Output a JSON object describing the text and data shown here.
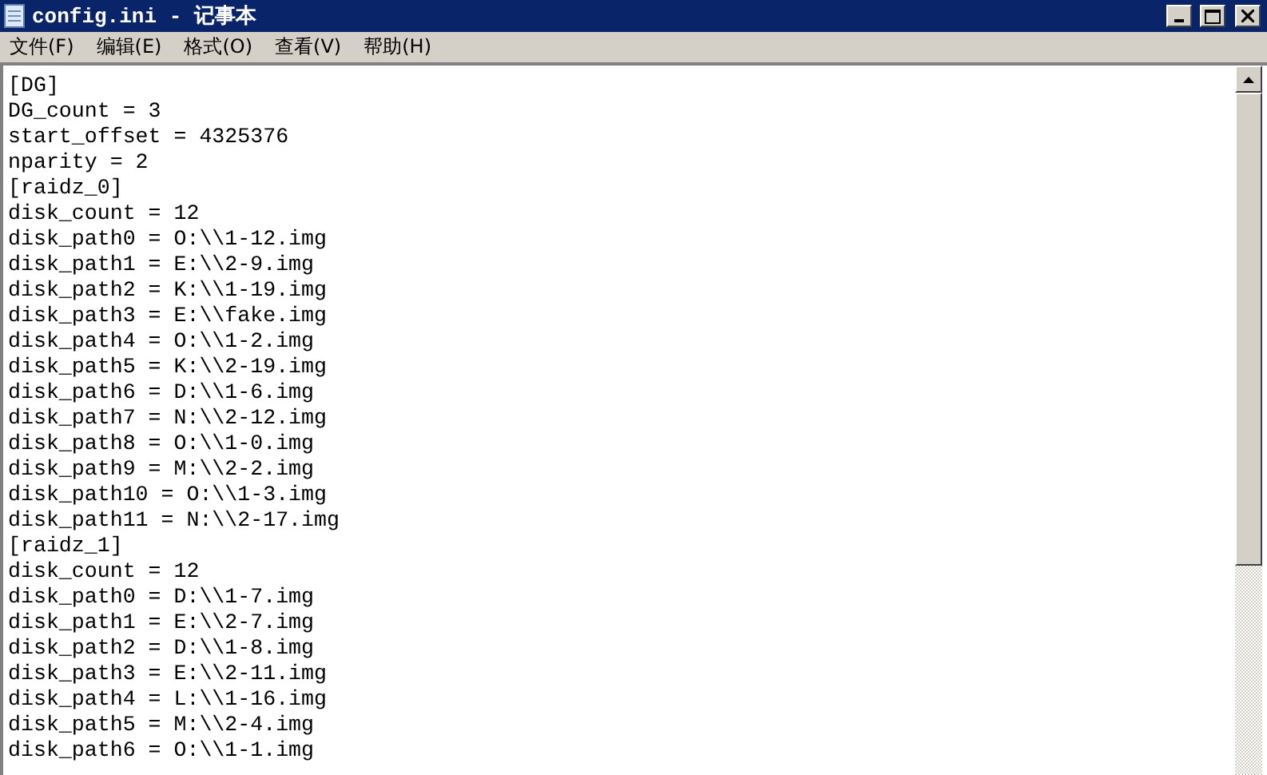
{
  "window": {
    "title": "config.ini - 记事本"
  },
  "menu": [
    "文件(F)",
    "编辑(E)",
    "格式(O)",
    "查看(V)",
    "帮助(H)"
  ],
  "editor": {
    "lines": [
      "[DG]",
      "DG_count = 3",
      "start_offset = 4325376",
      "nparity = 2",
      "[raidz_0]",
      "disk_count = 12",
      "disk_path0 = O:\\\\1-12.img",
      "disk_path1 = E:\\\\2-9.img",
      "disk_path2 = K:\\\\1-19.img",
      "disk_path3 = E:\\\\fake.img",
      "disk_path4 = O:\\\\1-2.img",
      "disk_path5 = K:\\\\2-19.img",
      "disk_path6 = D:\\\\1-6.img",
      "disk_path7 = N:\\\\2-12.img",
      "disk_path8 = O:\\\\1-0.img",
      "disk_path9 = M:\\\\2-2.img",
      "disk_path10 = O:\\\\1-3.img",
      "disk_path11 = N:\\\\2-17.img",
      "[raidz_1]",
      "disk_count = 12",
      "disk_path0 = D:\\\\1-7.img",
      "disk_path1 = E:\\\\2-7.img",
      "disk_path2 = D:\\\\1-8.img",
      "disk_path3 = E:\\\\2-11.img",
      "disk_path4 = L:\\\\1-16.img",
      "disk_path5 = M:\\\\2-4.img",
      "disk_path6 = O:\\\\1-1.img"
    ]
  }
}
